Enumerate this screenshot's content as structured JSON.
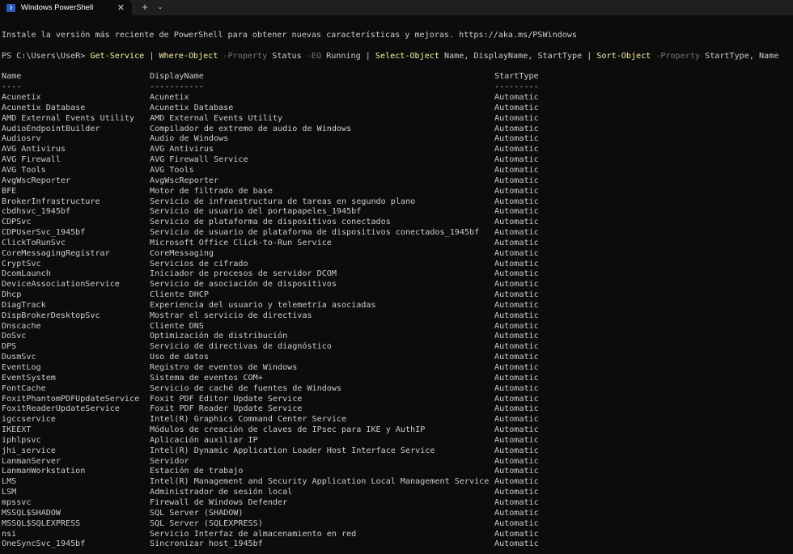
{
  "window": {
    "tab_title": "Windows PowerShell",
    "tab_close": "✕",
    "new_tab": "+",
    "dropdown": "⌄"
  },
  "terminal": {
    "banner": "Instale la versión más reciente de PowerShell para obtener nuevas características y mejoras. https://aka.ms/PSWindows",
    "prompt": "PS C:\\Users\\UseR> ",
    "cmd1": "Get-Service",
    "pipe1": " | ",
    "cmd2": "Where-Object",
    "param1": " -Property",
    "arg1": " Status ",
    "param2": "-EQ",
    "arg2": " Running | ",
    "cmd3": "Select-Object",
    "arg3": " Name, DisplayName, StartType | ",
    "cmd4": "Sort-Object",
    "param3": " -Property",
    "arg4": " StartType, Name",
    "headers": [
      "Name",
      "DisplayName",
      "StartType"
    ],
    "separators": [
      "----",
      "-----------",
      "---------"
    ],
    "rows": [
      [
        "Acunetix",
        "Acunetix",
        "Automatic"
      ],
      [
        "Acunetix Database",
        "Acunetix Database",
        "Automatic"
      ],
      [
        "AMD External Events Utility",
        "AMD External Events Utility",
        "Automatic"
      ],
      [
        "AudioEndpointBuilder",
        "Compilador de extremo de audio de Windows",
        "Automatic"
      ],
      [
        "Audiosrv",
        "Audio de Windows",
        "Automatic"
      ],
      [
        "AVG Antivirus",
        "AVG Antivirus",
        "Automatic"
      ],
      [
        "AVG Firewall",
        "AVG Firewall Service",
        "Automatic"
      ],
      [
        "AVG Tools",
        "AVG Tools",
        "Automatic"
      ],
      [
        "AvgWscReporter",
        "AvgWscReporter",
        "Automatic"
      ],
      [
        "BFE",
        "Motor de filtrado de base",
        "Automatic"
      ],
      [
        "BrokerInfrastructure",
        "Servicio de infraestructura de tareas en segundo plano",
        "Automatic"
      ],
      [
        "cbdhsvc_1945bf",
        "Servicio de usuario del portapapeles_1945bf",
        "Automatic"
      ],
      [
        "CDPSvc",
        "Servicio de plataforma de dispositivos conectados",
        "Automatic"
      ],
      [
        "CDPUserSvc_1945bf",
        "Servicio de usuario de plataforma de dispositivos conectados_1945bf",
        "Automatic"
      ],
      [
        "ClickToRunSvc",
        "Microsoft Office Click-to-Run Service",
        "Automatic"
      ],
      [
        "CoreMessagingRegistrar",
        "CoreMessaging",
        "Automatic"
      ],
      [
        "CryptSvc",
        "Servicios de cifrado",
        "Automatic"
      ],
      [
        "DcomLaunch",
        "Iniciador de procesos de servidor DCOM",
        "Automatic"
      ],
      [
        "DeviceAssociationService",
        "Servicio de asociación de dispositivos",
        "Automatic"
      ],
      [
        "Dhcp",
        "Cliente DHCP",
        "Automatic"
      ],
      [
        "DiagTrack",
        "Experiencia del usuario y telemetría asociadas",
        "Automatic"
      ],
      [
        "DispBrokerDesktopSvc",
        "Mostrar el servicio de directivas",
        "Automatic"
      ],
      [
        "Dnscache",
        "Cliente DNS",
        "Automatic"
      ],
      [
        "DoSvc",
        "Optimización de distribución",
        "Automatic"
      ],
      [
        "DPS",
        "Servicio de directivas de diagnóstico",
        "Automatic"
      ],
      [
        "DusmSvc",
        "Uso de datos",
        "Automatic"
      ],
      [
        "EventLog",
        "Registro de eventos de Windows",
        "Automatic"
      ],
      [
        "EventSystem",
        "Sistema de eventos COM+",
        "Automatic"
      ],
      [
        "FontCache",
        "Servicio de caché de fuentes de Windows",
        "Automatic"
      ],
      [
        "FoxitPhantomPDFUpdateService",
        "Foxit PDF Editor Update Service",
        "Automatic"
      ],
      [
        "FoxitReaderUpdateService",
        "Foxit PDF Reader Update Service",
        "Automatic"
      ],
      [
        "igccservice",
        "Intel(R) Graphics Command Center Service",
        "Automatic"
      ],
      [
        "IKEEXT",
        "Módulos de creación de claves de IPsec para IKE y AuthIP",
        "Automatic"
      ],
      [
        "iphlpsvc",
        "Aplicación auxiliar IP",
        "Automatic"
      ],
      [
        "jhi_service",
        "Intel(R) Dynamic Application Loader Host Interface Service",
        "Automatic"
      ],
      [
        "LanmanServer",
        "Servidor",
        "Automatic"
      ],
      [
        "LanmanWorkstation",
        "Estación de trabajo",
        "Automatic"
      ],
      [
        "LMS",
        "Intel(R) Management and Security Application Local Management Service",
        "Automatic"
      ],
      [
        "LSM",
        "Administrador de sesión local",
        "Automatic"
      ],
      [
        "mpssvc",
        "Firewall de Windows Defender",
        "Automatic"
      ],
      [
        "MSSQL$SHADOW",
        "SQL Server (SHADOW)",
        "Automatic"
      ],
      [
        "MSSQL$SQLEXPRESS",
        "SQL Server (SQLEXPRESS)",
        "Automatic"
      ],
      [
        "nsi",
        "Servicio Interfaz de almacenamiento en red",
        "Automatic"
      ],
      [
        "OneSyncSvc_1945bf",
        "Sincronizar host_1945bf",
        "Automatic"
      ]
    ]
  }
}
